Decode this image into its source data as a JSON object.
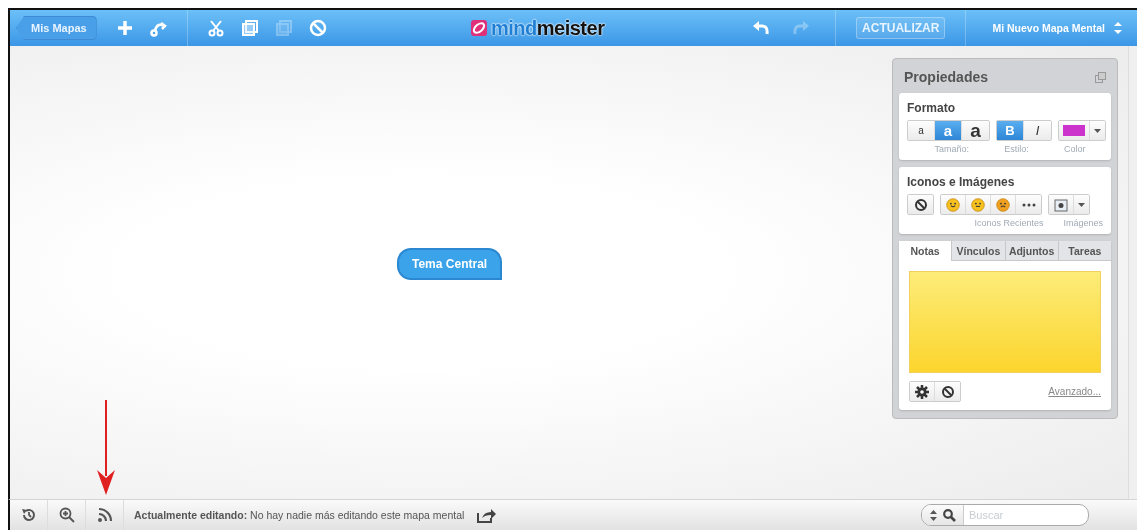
{
  "toolbar": {
    "back_button": "Mis Mapas",
    "tools": [
      {
        "kind": "add",
        "disabled": false
      },
      {
        "kind": "relink",
        "disabled": false
      },
      {
        "kind": "cut",
        "disabled": false
      },
      {
        "kind": "copy",
        "disabled": false
      },
      {
        "kind": "paste",
        "disabled": true
      },
      {
        "kind": "delete",
        "disabled": false
      }
    ],
    "logo": {
      "first": "mind",
      "second": "meister"
    },
    "history": [
      {
        "kind": "undo",
        "disabled": false
      },
      {
        "kind": "redo",
        "disabled": true
      }
    ],
    "update_button": "ACTUALIZAR",
    "map_name": "Mi Nuevo Mapa Mental"
  },
  "canvas": {
    "central_topic": "Tema Central"
  },
  "properties": {
    "title": "Propiedades",
    "format": {
      "title": "Formato",
      "sizes": [
        {
          "label": "a",
          "selected": false
        },
        {
          "label": "a",
          "selected": true
        },
        {
          "label": "a",
          "selected": false
        }
      ],
      "styles": [
        {
          "label": "B",
          "kind": "bold",
          "selected": true
        },
        {
          "label": "I",
          "kind": "italic",
          "selected": false
        }
      ],
      "color": "#cc33cc",
      "size_label": "Tamaño:",
      "style_label": "Estilo:",
      "color_label": "Color"
    },
    "icons": {
      "title": "Iconos e Imágenes",
      "recent": [
        {
          "kind": "happy"
        },
        {
          "kind": "neutral"
        },
        {
          "kind": "sad"
        },
        {
          "kind": "more"
        }
      ],
      "recent_label": "Iconos Recientes",
      "images_label": "Imágenes"
    },
    "tabs": [
      {
        "label": "Notas",
        "selected": true
      },
      {
        "label": "Vínculos",
        "selected": false
      },
      {
        "label": "Adjuntos",
        "selected": false
      },
      {
        "label": "Tareas",
        "selected": false
      }
    ],
    "advanced_link": "Avanzado..."
  },
  "status_bar": {
    "label": "Actualmente editando:",
    "text": "No hay nadie más editando este mapa mental",
    "search": {
      "placeholder": "Buscar"
    }
  }
}
